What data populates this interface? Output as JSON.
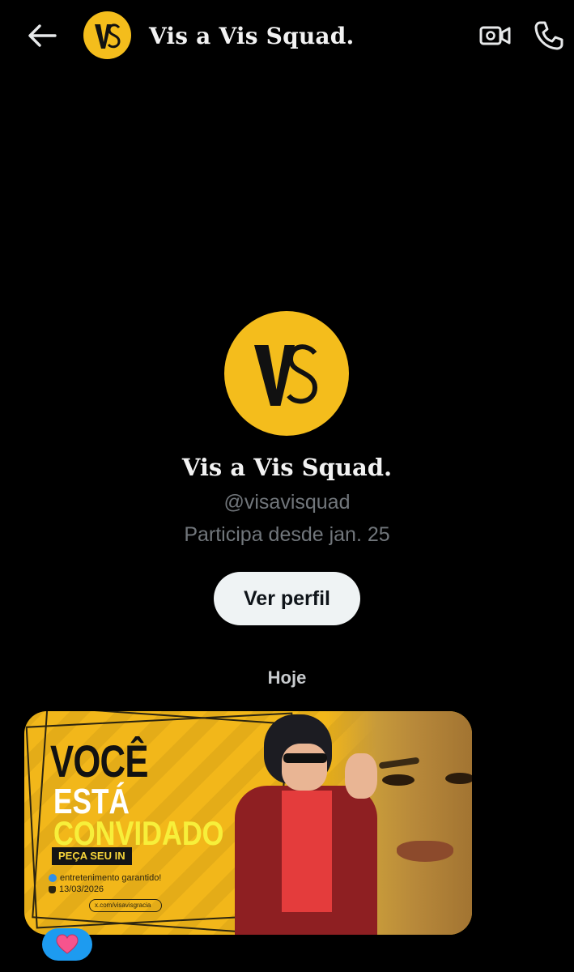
{
  "header": {
    "title": "Vis a Vis Squad.",
    "avatar_text": "VS"
  },
  "profile": {
    "avatar_text": "VS",
    "name": "Vis a Vis Squad.",
    "handle": "@visavisquad",
    "joined": "Participa desde jan. 25",
    "view_profile_label": "Ver perfil"
  },
  "conversation": {
    "day_separator": "Hoje",
    "message_image": {
      "headline_1": "VOCÊ",
      "headline_2": "ESTÁ",
      "headline_3": "CONVIDADO",
      "tag": "PEÇA SEU IN",
      "tagline": "entretenimento garantido!",
      "date": "13/03/2026",
      "url": "x.com/visavisgracia"
    },
    "reaction": "heart"
  },
  "colors": {
    "brand_yellow": "#f4bd1c",
    "background": "#000000",
    "accent_blue": "#1d9bf0",
    "reaction_heart": "#f6548d"
  },
  "icons": [
    "back-arrow-icon",
    "video-call-icon",
    "phone-icon",
    "heart-icon"
  ]
}
